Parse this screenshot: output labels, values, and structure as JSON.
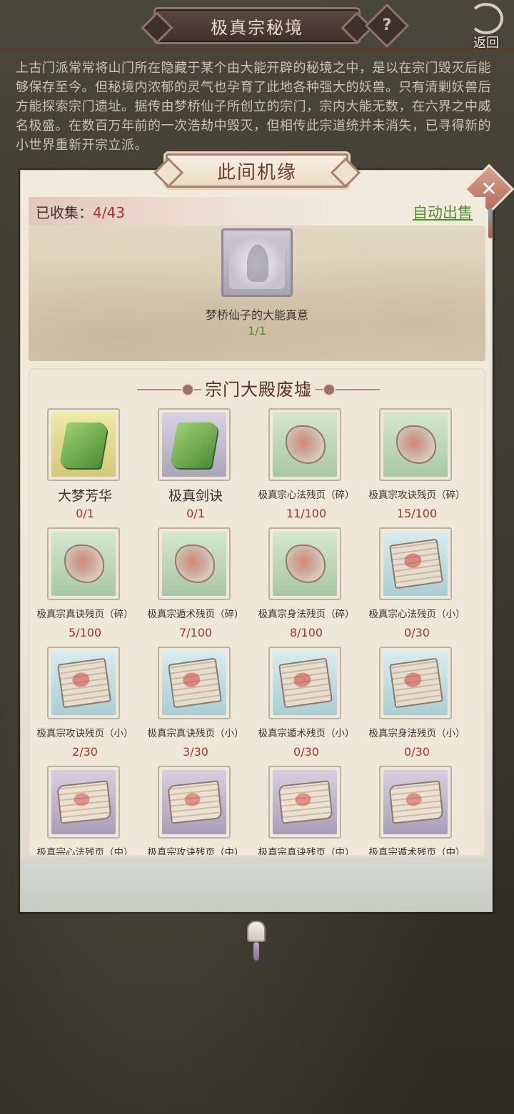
{
  "header": {
    "title": "极真宗秘境",
    "help_label": "?",
    "back_label": "返回"
  },
  "description": "上古门派常常将山门所在隐藏于某个由大能开辟的秘境之中，是以在宗门毁灭后能够保存至今。但秘境内浓郁的灵气也孕育了此地各种强大的妖兽。只有清剿妖兽后方能探索宗门遗址。据传由梦桥仙子所创立的宗门，宗内大能无数，在六界之中威名极盛。在数百万年前的一次浩劫中毁灭，但相传此宗道统并未消失，已寻得新的小世界重新开宗立派。",
  "modal": {
    "title": "此间机缘",
    "close_label": "✕",
    "collected_label": "已收集：",
    "collected_value": "4/43",
    "auto_sell": "自动出售",
    "feature": {
      "name": "梦桥仙子的大能真意",
      "count": "1/1"
    },
    "section_title": "宗门大殿废墟",
    "items": [
      {
        "name": "大梦芳华",
        "count": "0/1",
        "rarity": "yellow",
        "icon": "book-icon"
      },
      {
        "name": "极真剑诀",
        "count": "0/1",
        "rarity": "purple",
        "icon": "book-icon"
      },
      {
        "name": "极真宗心法残页（碎）",
        "count": "11/100",
        "rarity": "green",
        "icon": "fragment-icon"
      },
      {
        "name": "极真宗攻诀残页（碎）",
        "count": "15/100",
        "rarity": "green",
        "icon": "fragment-icon"
      },
      {
        "name": "极真宗真诀残页（碎）",
        "count": "5/100",
        "rarity": "green",
        "icon": "fragment-icon"
      },
      {
        "name": "极真宗遁术残页（碎）",
        "count": "7/100",
        "rarity": "green",
        "icon": "fragment-icon"
      },
      {
        "name": "极真宗身法残页（碎）",
        "count": "8/100",
        "rarity": "green",
        "icon": "fragment-icon"
      },
      {
        "name": "极真宗心法残页（小）",
        "count": "0/30",
        "rarity": "blue",
        "icon": "page-icon"
      },
      {
        "name": "极真宗攻诀残页（小）",
        "count": "2/30",
        "rarity": "blue",
        "icon": "page-icon"
      },
      {
        "name": "极真宗真诀残页（小）",
        "count": "3/30",
        "rarity": "blue",
        "icon": "page-icon"
      },
      {
        "name": "极真宗遁术残页（小）",
        "count": "0/30",
        "rarity": "blue",
        "icon": "page-icon"
      },
      {
        "name": "极真宗身法残页（小）",
        "count": "0/30",
        "rarity": "blue",
        "icon": "page-icon"
      },
      {
        "name": "极真宗心法残页（中）",
        "count": "",
        "rarity": "violet",
        "icon": "scroll-icon"
      },
      {
        "name": "极真宗攻诀残页（中）",
        "count": "",
        "rarity": "violet",
        "icon": "scroll-icon"
      },
      {
        "name": "极真宗真诀残页（中）",
        "count": "",
        "rarity": "violet",
        "icon": "scroll-icon"
      },
      {
        "name": "极真宗遁术残页（中）",
        "count": "",
        "rarity": "violet",
        "icon": "scroll-icon"
      }
    ]
  },
  "colors": {
    "accent_red": "#a2362d",
    "accent_green": "#4f8e2d",
    "title_brown": "#6b3f36"
  }
}
